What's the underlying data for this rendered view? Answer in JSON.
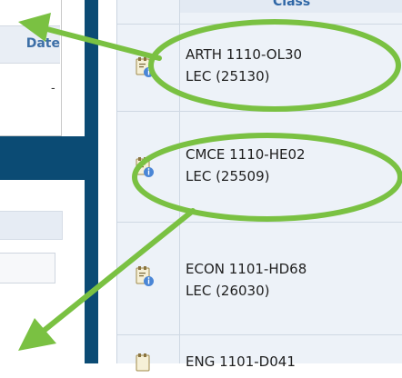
{
  "left_panel": {
    "date_header_label": "Date",
    "dash_value": "-"
  },
  "table": {
    "header_label": "Class",
    "rows": [
      {
        "line1": "ARTH 1110-OL30",
        "line2": "LEC (25130)"
      },
      {
        "line1": "CMCE 1110-HE02",
        "line2": "LEC (25509)"
      },
      {
        "line1": "ECON 1101-HD68",
        "line2": "LEC (26030)"
      },
      {
        "line1": "ENG 1101-D041",
        "line2": ""
      }
    ]
  },
  "colors": {
    "highlight_green": "#7ac142",
    "navy": "#0b4b74",
    "link_blue": "#2f67a6"
  },
  "icons": [
    "class-detail-icon",
    "info-icon",
    "arrow-icon"
  ]
}
